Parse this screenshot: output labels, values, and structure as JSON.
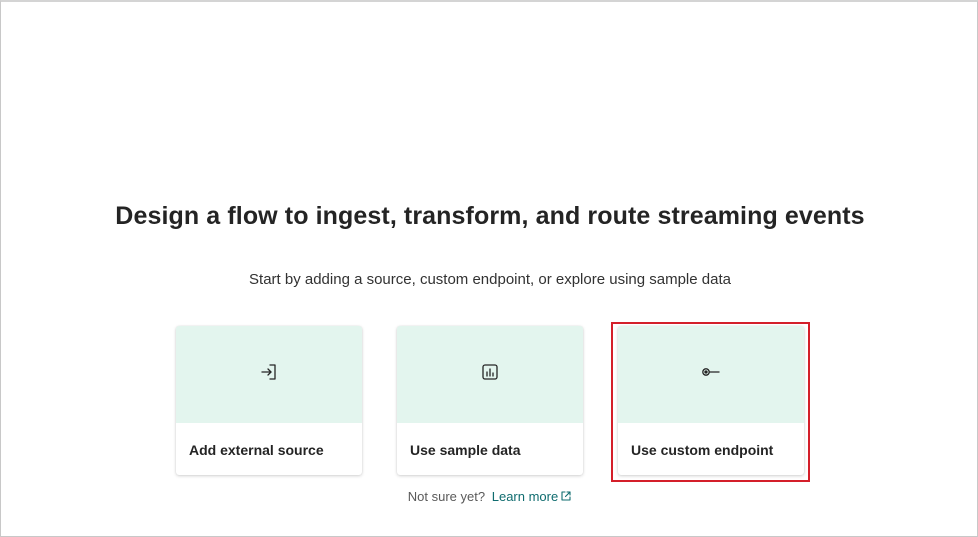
{
  "main": {
    "title": "Design a flow to ingest, transform, and route streaming events",
    "subtitle": "Start by adding a source, custom endpoint, or explore using sample data"
  },
  "cards": [
    {
      "label": "Add external source",
      "icon": "sign-in-arrow-icon"
    },
    {
      "label": "Use sample data",
      "icon": "bar-chart-icon"
    },
    {
      "label": "Use custom endpoint",
      "icon": "endpoint-icon"
    }
  ],
  "footer": {
    "prompt": "Not sure yet?",
    "link_label": "Learn more",
    "link_icon": "external-link-icon"
  },
  "colors": {
    "card_tint": "#e3f5ee",
    "link": "#0f6c6f",
    "highlight": "#d41f2a"
  }
}
